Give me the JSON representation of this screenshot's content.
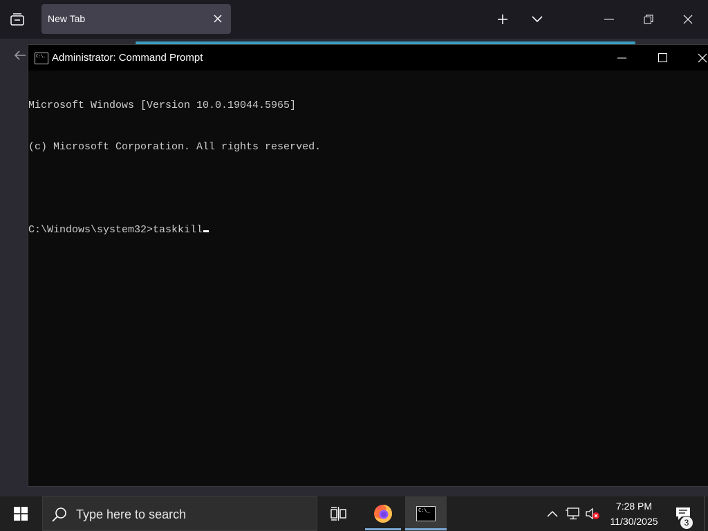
{
  "browser": {
    "tab_title": "New Tab"
  },
  "cmd_window": {
    "title": "Administrator: Command Prompt",
    "icon_text": "C:\\.",
    "output_lines": [
      "Microsoft Windows [Version 10.0.19044.5965]",
      "(c) Microsoft Corporation. All rights reserved.",
      "",
      "C:\\Windows\\system32>taskkill"
    ]
  },
  "taskbar": {
    "search_placeholder": "Type here to search",
    "clock_time": "7:28 PM",
    "clock_date": "11/30/2025",
    "notification_count": "3",
    "taskbar_icon_text": "C:\\_"
  },
  "colors": {
    "cmd_background": "#0c0c0c",
    "cmd_text": "#cccccc",
    "taskbar_background": "#202020",
    "active_underline": "#7aa8d6"
  },
  "icons": [
    "tab-list-icon",
    "close-icon",
    "plus-icon",
    "chevron-down-icon",
    "minimize-icon",
    "restore-icon",
    "back-arrow-icon",
    "windows-logo-icon",
    "search-icon",
    "task-view-icon",
    "firefox-icon",
    "cmd-icon",
    "chevron-up-icon",
    "network-icon",
    "volume-muted-icon",
    "notification-icon"
  ]
}
